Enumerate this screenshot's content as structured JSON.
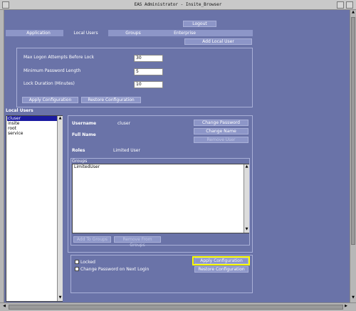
{
  "window": {
    "title": "EAS Administrator - Insite_Browser"
  },
  "header": {
    "logout_label": "Logout",
    "add_local_user_label": "Add Local User"
  },
  "tabs": [
    {
      "label": "Application",
      "active": false
    },
    {
      "label": "Local Users",
      "active": true
    },
    {
      "label": "Groups",
      "active": false
    },
    {
      "label": "Enterprise",
      "active": false
    }
  ],
  "policy": {
    "max_attempts_label": "Max Logon Attempts Before Lock",
    "max_attempts_value": "30",
    "min_password_label": "Minimum Password Length",
    "min_password_value": "5",
    "lock_duration_label": "Lock Duration (Minutes)",
    "lock_duration_value": "10",
    "apply_label": "Apply Configuration",
    "restore_label": "Restore Configuration"
  },
  "local_users": {
    "title": "Local Users",
    "items": [
      "cluser",
      "insite",
      "root",
      "service"
    ],
    "selected": "cluser"
  },
  "user_details": {
    "username_label": "Username",
    "username_value": "cluser",
    "fullname_label": "Full Name",
    "roles_label": "Roles",
    "roles_value": "Limited User",
    "change_password_label": "Change Password",
    "change_name_label": "Change Name",
    "remove_user_label": "Remove User",
    "groups_label": "Groups",
    "groups": [
      "LimitedUser"
    ],
    "add_to_groups_label": "Add To Groups",
    "remove_from_groups_label": "Remove From Groups"
  },
  "options": {
    "locked_label": "Locked",
    "change_password_next_login_label": "Change Password on Next Login",
    "apply_label": "Apply Configuration",
    "restore_label": "Restore Configuration",
    "highlight_color": "#ffff00"
  }
}
